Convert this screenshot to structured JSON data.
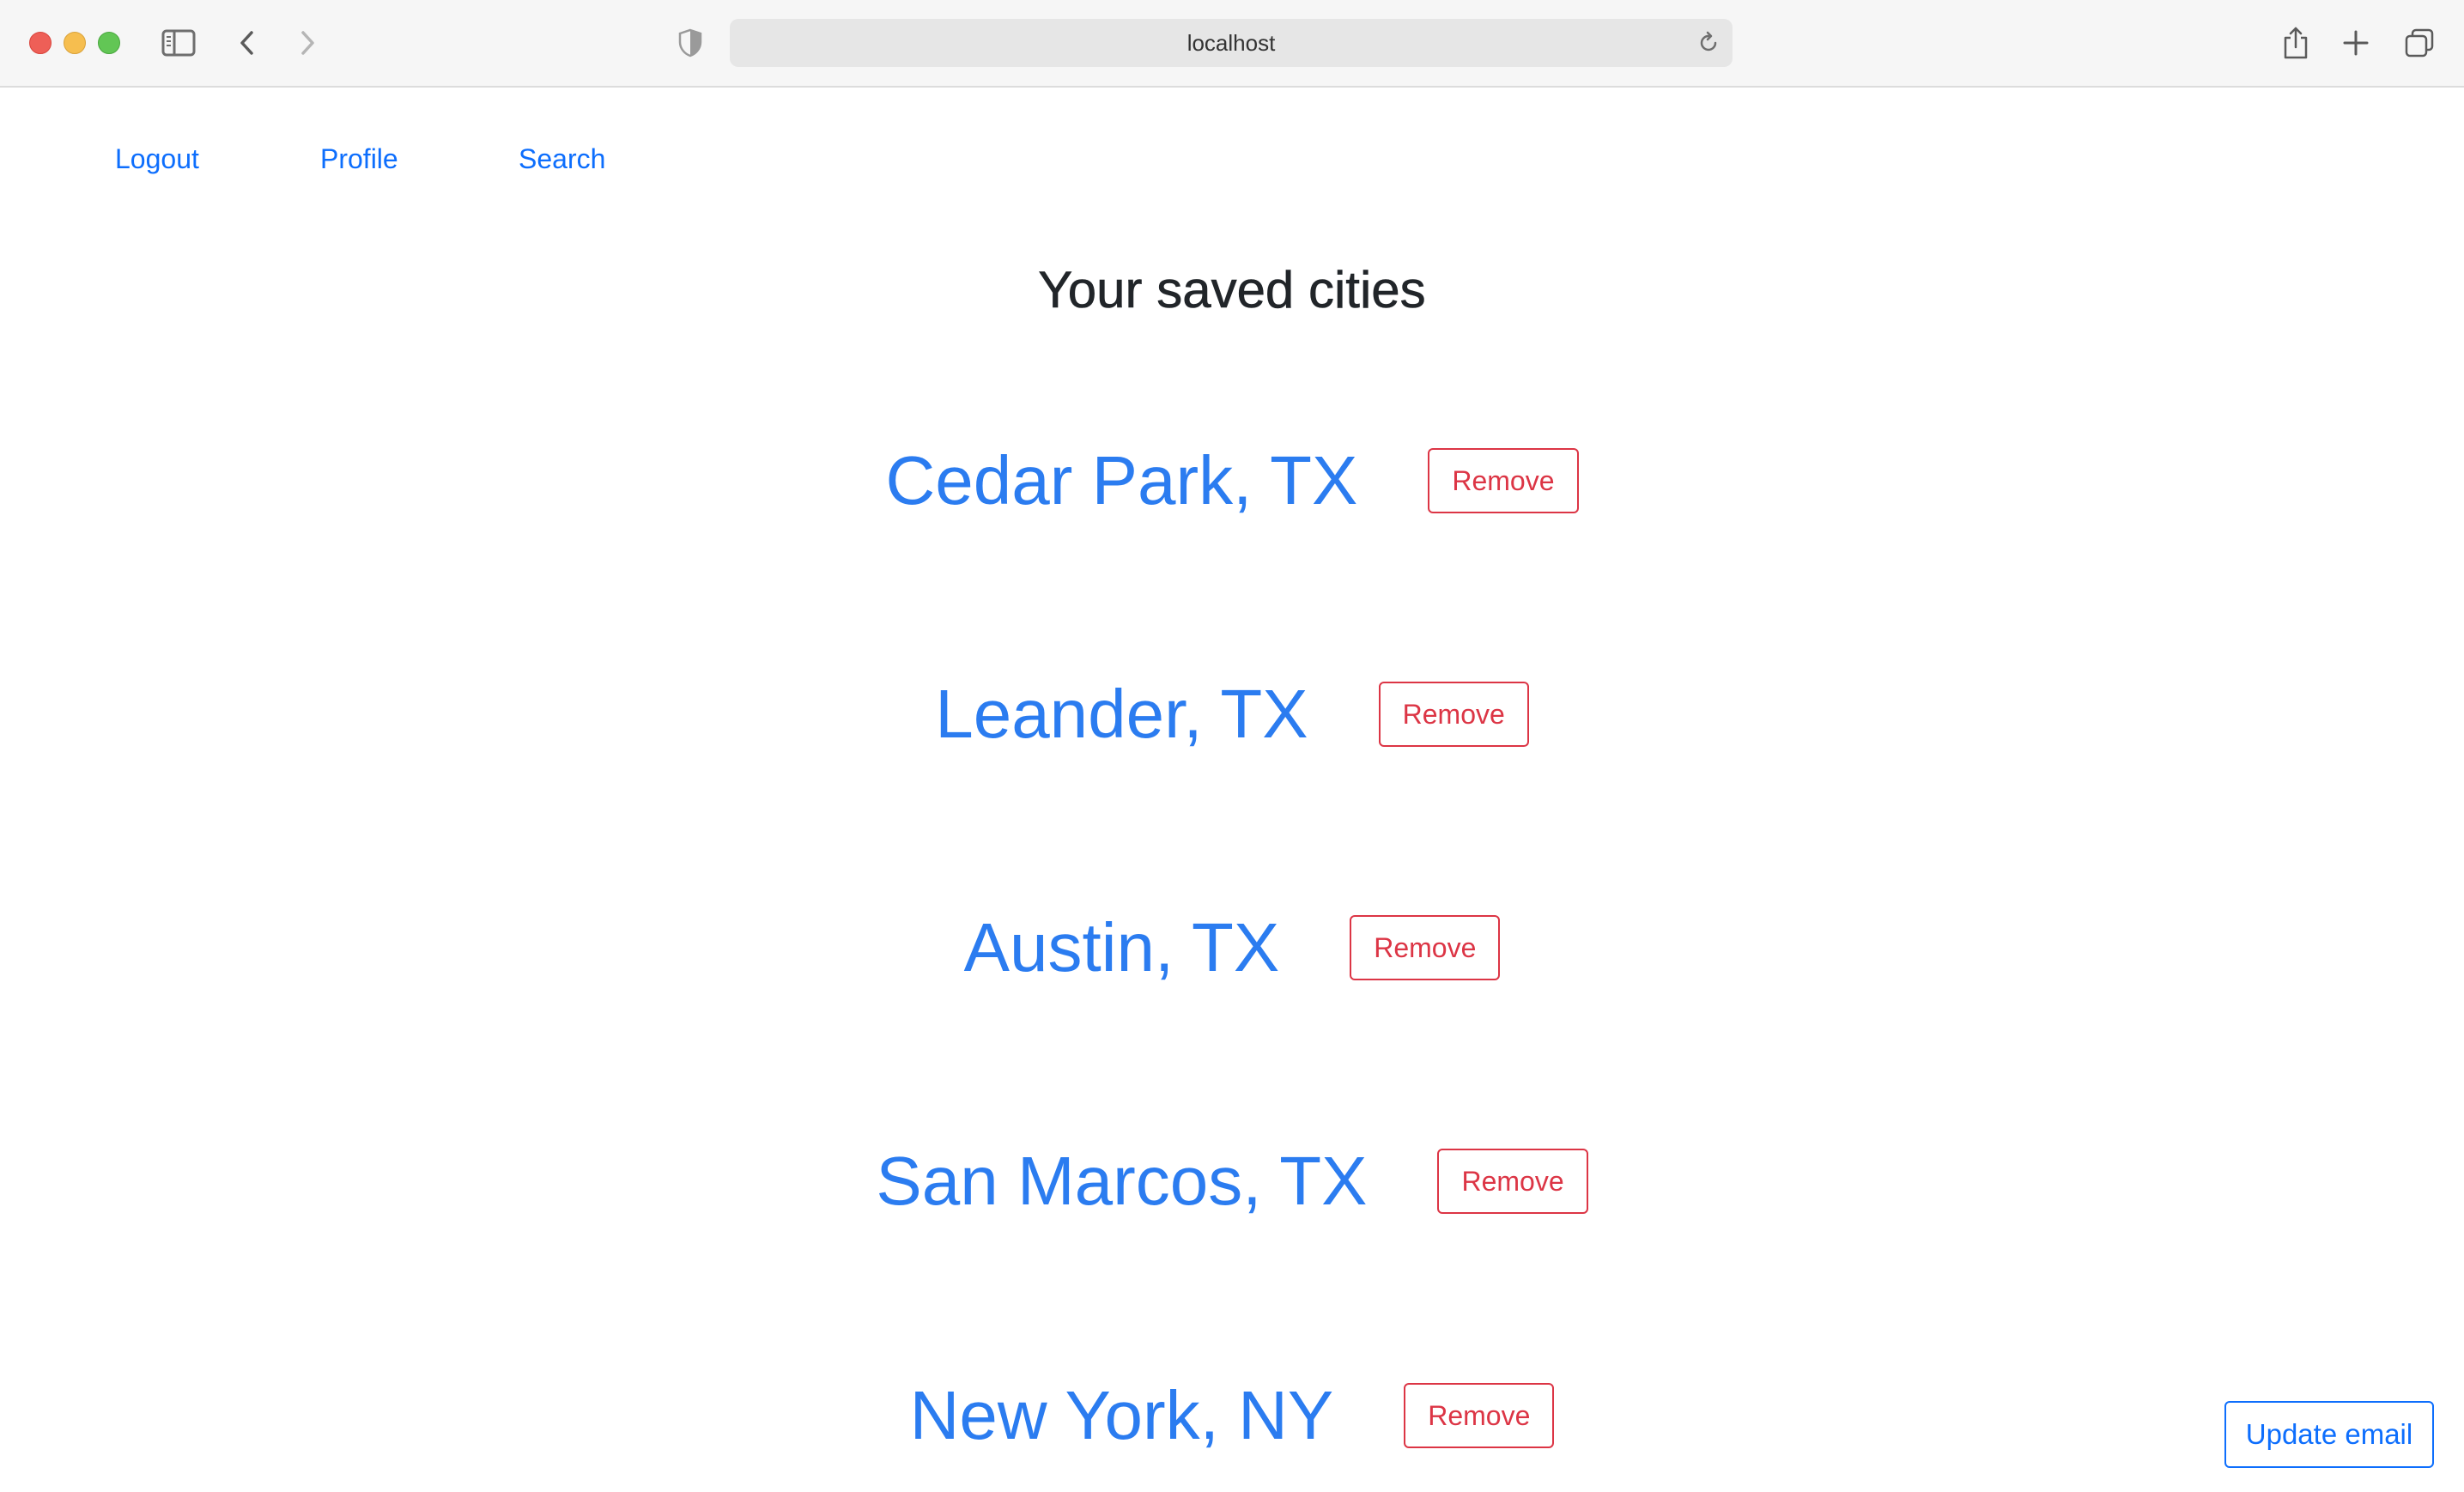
{
  "browser": {
    "url": "localhost",
    "icons": [
      "close-window-icon",
      "minimize-window-icon",
      "zoom-window-icon",
      "sidebar-icon",
      "back-icon",
      "forward-icon",
      "privacy-shield-icon",
      "reload-icon",
      "share-icon",
      "new-tab-icon",
      "tab-overview-icon"
    ]
  },
  "nav": {
    "logout": "Logout",
    "profile": "Profile",
    "search": "Search"
  },
  "page": {
    "title": "Your saved cities"
  },
  "cities": [
    {
      "name": "Cedar Park, TX",
      "remove_label": "Remove"
    },
    {
      "name": "Leander, TX",
      "remove_label": "Remove"
    },
    {
      "name": "Austin, TX",
      "remove_label": "Remove"
    },
    {
      "name": "San Marcos, TX",
      "remove_label": "Remove"
    },
    {
      "name": "New York, NY",
      "remove_label": "Remove"
    }
  ],
  "actions": {
    "update_email": "Update email"
  },
  "colors": {
    "link": "#0d6efd",
    "city_link": "#2b7cf0",
    "danger": "#dc3545",
    "heading": "#212529"
  }
}
